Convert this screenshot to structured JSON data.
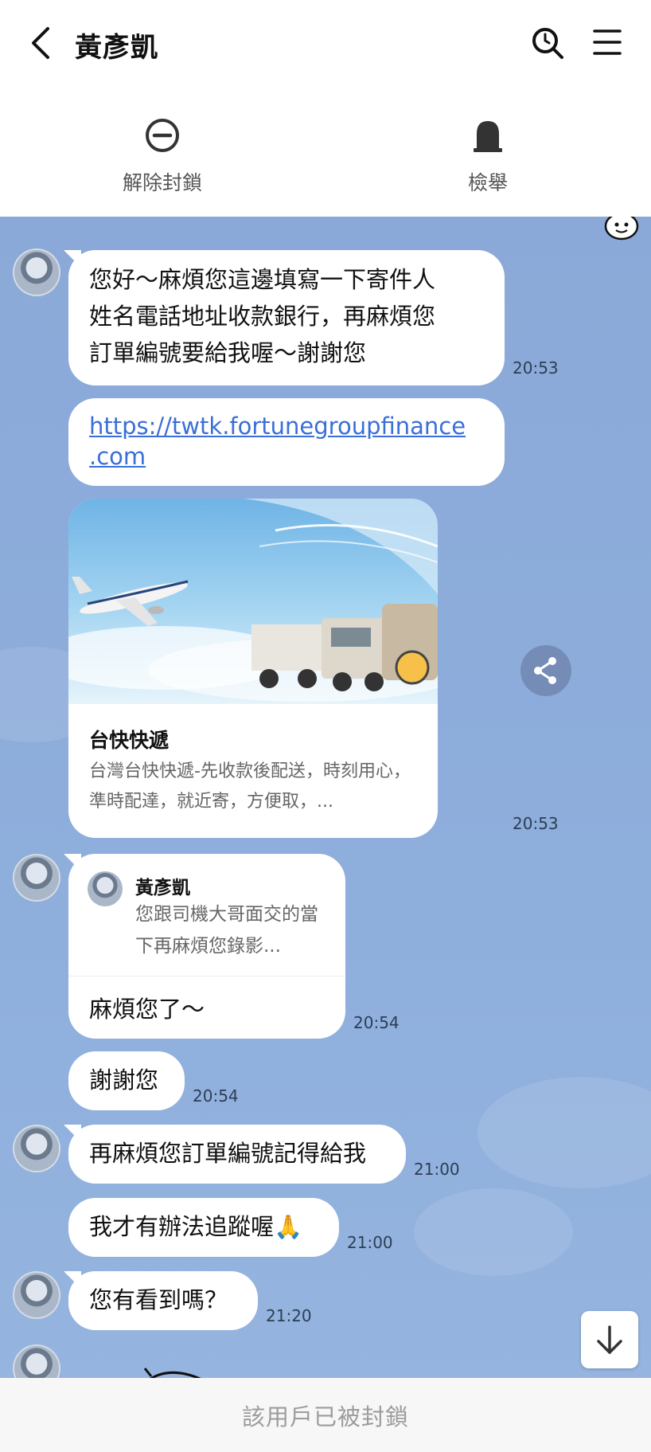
{
  "header": {
    "title": "黃彥凱",
    "back_icon": "chevron-left-icon",
    "search_icon": "search-icon",
    "menu_icon": "menu-icon"
  },
  "actions": [
    {
      "label": "解除封鎖",
      "icon": "unblock-icon"
    },
    {
      "label": "檢舉",
      "icon": "report-icon"
    }
  ],
  "messages": {
    "m1": {
      "text": "您好～麻煩您這邊填寫一下寄件人姓名電話地址收款銀行，再麻煩您訂單編號要給我喔～謝謝您",
      "line1": "您好～麻煩您這邊填寫一下寄件人",
      "line2": "姓名電話地址收款銀行，再麻煩您",
      "line3": "訂單編號要給我喔～謝謝您",
      "time": "20:53"
    },
    "m2": {
      "link_line1": "https://twtk.fortunegroupfinance",
      "link_line2": ".com"
    },
    "m3": {
      "card_title": "台快快遞",
      "card_desc": "台灣台快快遞-先收款後配送，時刻用心，準時配達，就近寄，方便取，...",
      "time": "20:53"
    },
    "m4": {
      "reply_name": "黃彥凱",
      "reply_text": "您跟司機大哥面交的當下再麻煩您錄影...",
      "text": "麻煩您了～",
      "time": "20:54"
    },
    "m5": {
      "text": "謝謝您",
      "time": "20:54"
    },
    "m6": {
      "text": "再麻煩您訂單編號記得給我",
      "time": "21:00"
    },
    "m7": {
      "text": "我才有辦法追蹤喔🙏",
      "time": "21:00"
    },
    "m8": {
      "text": "您有看到嗎？",
      "time": "21:20"
    }
  },
  "footer": {
    "text": "該用戶已被封鎖"
  },
  "colors": {
    "chat_bg": "#8eaedc",
    "link": "#3a6fd8",
    "bubble": "#ffffff"
  }
}
